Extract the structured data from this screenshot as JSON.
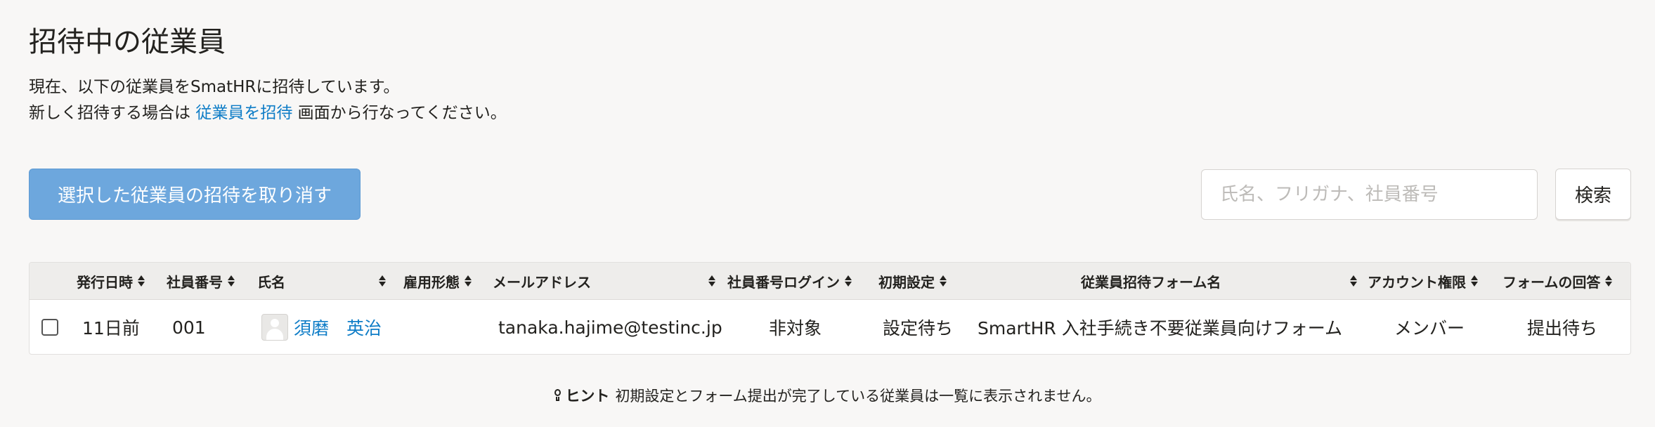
{
  "page": {
    "title": "招待中の従業員",
    "description_line1": "現在、以下の従業員をSmatHRに招待しています。",
    "description_line2_prefix": "新しく招待する場合は",
    "description_link": "従業員を招待",
    "description_line2_suffix": "画面から行なってください。"
  },
  "toolbar": {
    "cancel_invite_label": "選択した従業員の招待を取り消す",
    "search_placeholder": "氏名、フリガナ、社員番号",
    "search_button_label": "検索"
  },
  "table": {
    "columns": [
      "発行日時",
      "社員番号",
      "氏名",
      "雇用形態",
      "メールアドレス",
      "社員番号ログイン",
      "初期設定",
      "従業員招待フォーム名",
      "アカウント権限",
      "フォームの回答"
    ],
    "rows": [
      {
        "issued": "11日前",
        "employee_number": "001",
        "name": "須磨　英治",
        "employment_type": "",
        "email": "tanaka.hajime@testinc.jp",
        "number_login": "非対象",
        "initial_setup": "設定待ち",
        "form_name": "SmartHR 入社手続き不要従業員向けフォーム",
        "account_role": "メンバー",
        "form_response": "提出待ち"
      }
    ]
  },
  "hint": {
    "label": "ヒント",
    "text": "初期設定とフォーム提出が完了している従業員は一覧に表示されません。"
  },
  "colors": {
    "primary_button": "#6da7dd",
    "link": "#0f7dc7",
    "background": "#f8f7f6"
  }
}
